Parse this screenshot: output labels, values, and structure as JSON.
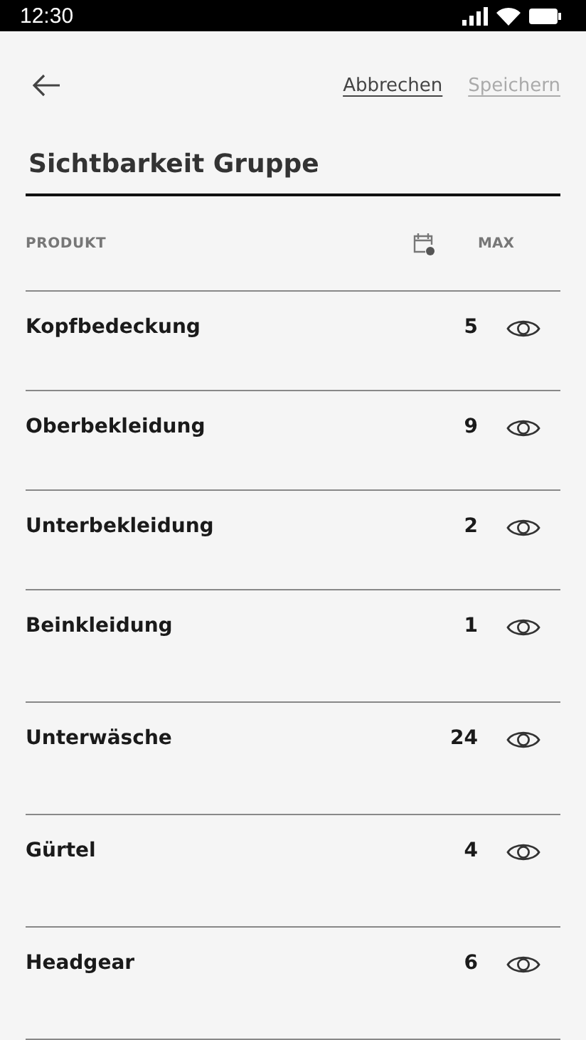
{
  "status_bar": {
    "time": "12:30"
  },
  "toolbar": {
    "actions": [
      {
        "label": "Abbrechen",
        "disabled": false
      },
      {
        "label": "Speichern",
        "disabled": true
      }
    ]
  },
  "title": "Sichtbarkeit Gruppe",
  "table": {
    "columns": {
      "product": "PRODUKT",
      "max": "MAX"
    },
    "rows": [
      {
        "name": "Kopfbedeckung",
        "max": "5"
      },
      {
        "name": "Oberbekleidung",
        "max": "9"
      },
      {
        "name": "Unterbekleidung",
        "max": "2"
      },
      {
        "name": "Beinkleidung",
        "max": "1"
      },
      {
        "name": "Unterwäsche",
        "max": "24"
      },
      {
        "name": "Gürtel",
        "max": "4"
      },
      {
        "name": "Headgear",
        "max": "6"
      }
    ]
  }
}
